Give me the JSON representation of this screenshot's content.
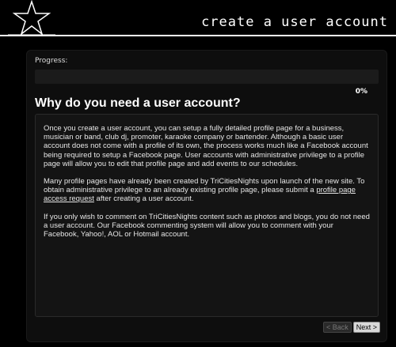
{
  "header": {
    "title": "create a user account"
  },
  "progress": {
    "label": "Progress:",
    "value": 0,
    "value_text": "0%"
  },
  "section": {
    "heading": "Why do you need a user account?",
    "p1": "Once you create a user account, you can setup a fully detailed profile page for a business, musician or band, club dj, promoter, karaoke company or bartender. Although a basic user account does not come with a profile of its own, the process works much like a Facebook account being required to setup a Facebook page. User accounts with administrative privilege to a profile page will allow you to edit that profile page and add events to our schedules.",
    "p2_before": "Many profile pages have already been created by TriCitiesNights upon launch of the new site. To obtain administrative privilege to an already existing profile page, please submit a ",
    "p2_link": "profile page access request",
    "p2_after": " after creating a user account.",
    "p3": "If you only wish to comment on TriCitiesNights content such as photos and blogs, you do not need a user account. Our Facebook commenting system will allow you to comment with your Facebook, Yahoo!, AOL or Hotmail account."
  },
  "nav": {
    "back_label": "< Back",
    "next_label": "Next >"
  }
}
